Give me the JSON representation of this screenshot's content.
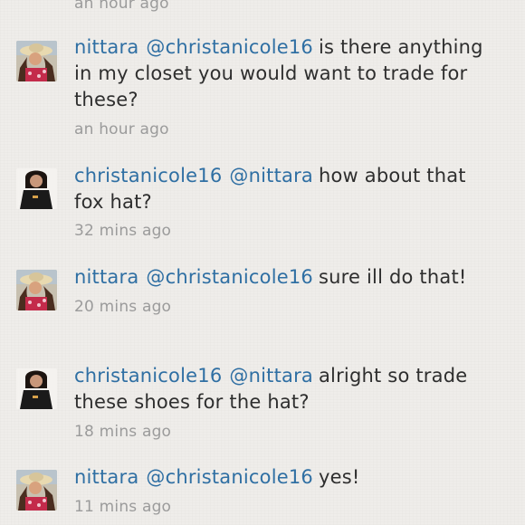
{
  "top_time": "an hour ago",
  "comments": [
    {
      "avatar": "nittara",
      "user": "nittara",
      "mention": "@christanicole16",
      "text": "is there anything in my closet you would want to trade for these?",
      "time": "an hour ago"
    },
    {
      "avatar": "christanicole16",
      "user": "christanicole16",
      "mention": "@nittara",
      "text": "how about that fox hat?",
      "time": "32 mins ago"
    },
    {
      "avatar": "nittara",
      "user": "nittara",
      "mention": "@christanicole16",
      "text": "sure ill do that!",
      "time": "20 mins ago"
    },
    {
      "avatar": "christanicole16",
      "user": "christanicole16",
      "mention": "@nittara",
      "text": "alright so trade these shoes for the hat?",
      "time": "18 mins ago"
    },
    {
      "avatar": "nittara",
      "user": "nittara",
      "mention": "@christanicole16",
      "text": "yes!",
      "time": "11 mins ago"
    }
  ]
}
